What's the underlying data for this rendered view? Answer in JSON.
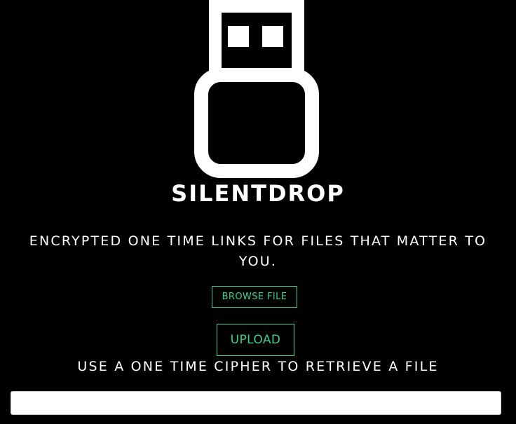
{
  "logo": {
    "icon": "usb-drive-icon",
    "color": "#ffffff"
  },
  "brand": {
    "name": "SILENTDROP"
  },
  "tagline": {
    "text": "ENCRYPTED ONE TIME LINKS FOR FILES THAT MATTER TO YOU."
  },
  "upload": {
    "browse_label": "BROWSE FILE",
    "upload_label": "UPLOAD",
    "accent_color": "#3ecf8e"
  },
  "retrieve": {
    "label": "USE A ONE TIME CIPHER TO RETRIEVE A FILE",
    "cipher_value": "",
    "cipher_placeholder": ""
  },
  "theme": {
    "background": "#000000",
    "text": "#ffffff"
  }
}
